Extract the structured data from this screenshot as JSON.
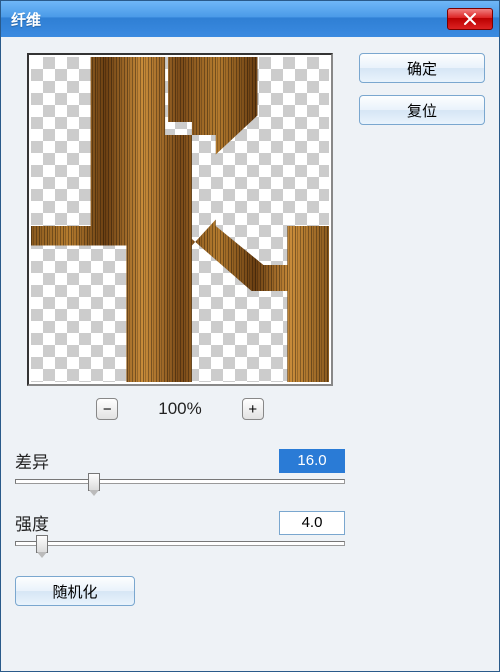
{
  "window": {
    "title": "纤维"
  },
  "buttons": {
    "ok": "确定",
    "reset": "复位",
    "randomize": "随机化"
  },
  "zoom": {
    "level": "100%"
  },
  "sliders": {
    "variance": {
      "label": "差异",
      "value": "16.0",
      "pos_pct": 22
    },
    "strength": {
      "label": "强度",
      "value": "4.0",
      "pos_pct": 6
    }
  }
}
